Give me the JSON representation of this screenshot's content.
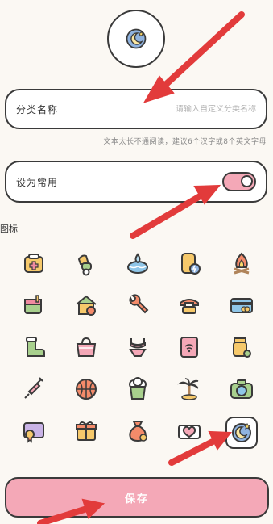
{
  "name_field": {
    "label": "分类名称",
    "placeholder": "请输入自定义分类名称",
    "hint": "文本太长不通阅读，建议6个汉字或8个英文字母"
  },
  "common_toggle": {
    "label": "设为常用",
    "on": true,
    "color": "#f4a8b7"
  },
  "icons_section": {
    "title": "图标"
  },
  "icons": [
    "medical-kit-icon",
    "scooter-icon",
    "water-drop-bowl-icon",
    "power-bank-icon",
    "campfire-icon",
    "mailbox-icon",
    "home-icon",
    "wrench-icon",
    "telephone-icon",
    "credit-card-icon",
    "boot-icon",
    "handbag-icon",
    "swimsuit-icon",
    "router-icon",
    "tea-tin-icon",
    "syringe-icon",
    "basketball-icon",
    "popcorn-icon",
    "palm-tree-icon",
    "camera-icon",
    "certificate-icon",
    "gift-icon",
    "money-bag-icon",
    "heart-card-icon",
    "moon-star-icon"
  ],
  "selected_icon": "moon-star-icon",
  "save_button": {
    "label": "保存",
    "color": "#f4a8b7"
  },
  "accent_arrow_color": "#e23b3b"
}
